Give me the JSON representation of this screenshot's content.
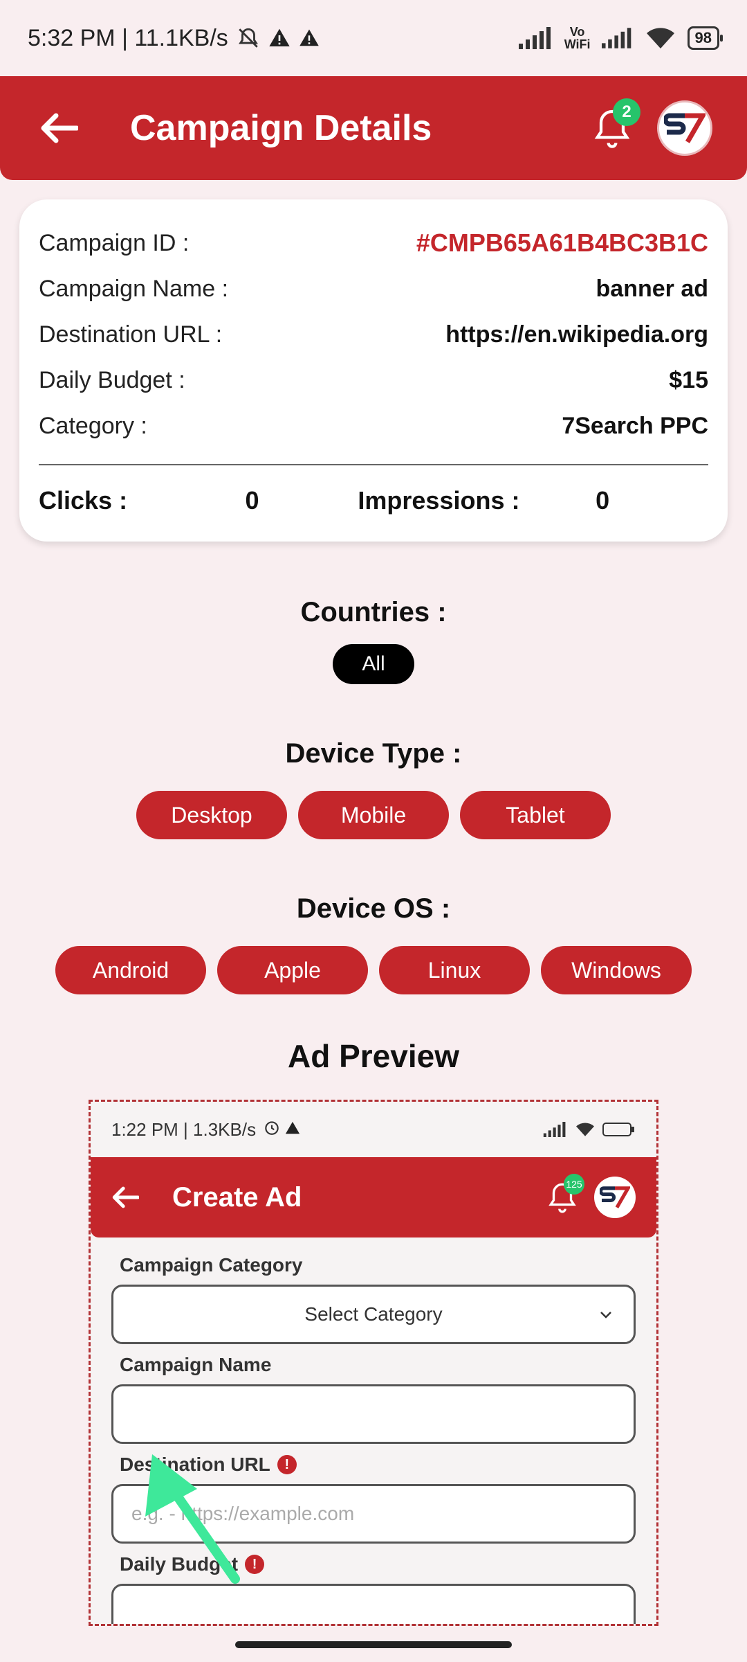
{
  "status_bar": {
    "time_speed": "5:32 PM | 11.1KB/s",
    "vowifi_top": "Vo",
    "vowifi_bottom": "WiFi",
    "battery": "98"
  },
  "header": {
    "title": "Campaign Details",
    "notification_count": "2"
  },
  "details": {
    "rows": [
      {
        "label": "Campaign ID :",
        "value": "#CMPB65A61B4BC3B1C"
      },
      {
        "label": "Campaign Name :",
        "value": "banner ad"
      },
      {
        "label": "Destination URL :",
        "value": "https://en.wikipedia.org"
      },
      {
        "label": "Daily Budget :",
        "value": "$15"
      },
      {
        "label": "Category :",
        "value": "7Search PPC"
      }
    ],
    "clicks_label": "Clicks :",
    "clicks_value": "0",
    "impressions_label": "Impressions :",
    "impressions_value": "0"
  },
  "countries": {
    "title": "Countries :",
    "items": [
      "All"
    ]
  },
  "device_type": {
    "title": "Device Type :",
    "items": [
      "Desktop",
      "Mobile",
      "Tablet"
    ]
  },
  "device_os": {
    "title": "Device OS :",
    "items": [
      "Android",
      "Apple",
      "Linux",
      "Windows"
    ]
  },
  "ad_preview": {
    "title": "Ad Preview",
    "status_text": "1:22 PM | 1.3KB/s",
    "header_title": "Create Ad",
    "notification_count": "125",
    "campaign_category_label": "Campaign Category",
    "select_category": "Select Category",
    "campaign_name_label": "Campaign Name",
    "destination_url_label": "Destination URL",
    "destination_url_placeholder": "e.g. - https://example.com",
    "daily_budget_label": "Daily Budget",
    "info_icon": "!"
  },
  "colors": {
    "brand_red": "#c4262b",
    "badge_green": "#27c46b",
    "background": "#f9eef0"
  }
}
